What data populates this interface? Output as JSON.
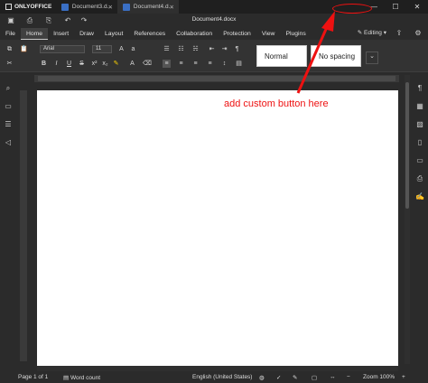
{
  "app": {
    "brand": "ONLYOFFICE",
    "tabs": [
      {
        "label": "Document3.d..."
      },
      {
        "label": "Document4.d..."
      }
    ]
  },
  "document_title": "Document4.docx",
  "window_controls": {
    "minimize": "—",
    "maximize": "☐",
    "close": "✕"
  },
  "menu": [
    "File",
    "Home",
    "Insert",
    "Draw",
    "Layout",
    "References",
    "Collaboration",
    "Protection",
    "View",
    "Plugins"
  ],
  "active_menu": "Home",
  "editing_label": "Editing",
  "ribbon": {
    "font_name": "Arial",
    "font_size": "11",
    "style_normal": "Normal",
    "style_nospacing": "No spacing"
  },
  "annotation": {
    "text": "add custom button here",
    "color": "#ee1111"
  },
  "status": {
    "page": "Page 1 of 1",
    "word_count": "Word count",
    "language": "English (United States)",
    "zoom": "Zoom 100%"
  }
}
